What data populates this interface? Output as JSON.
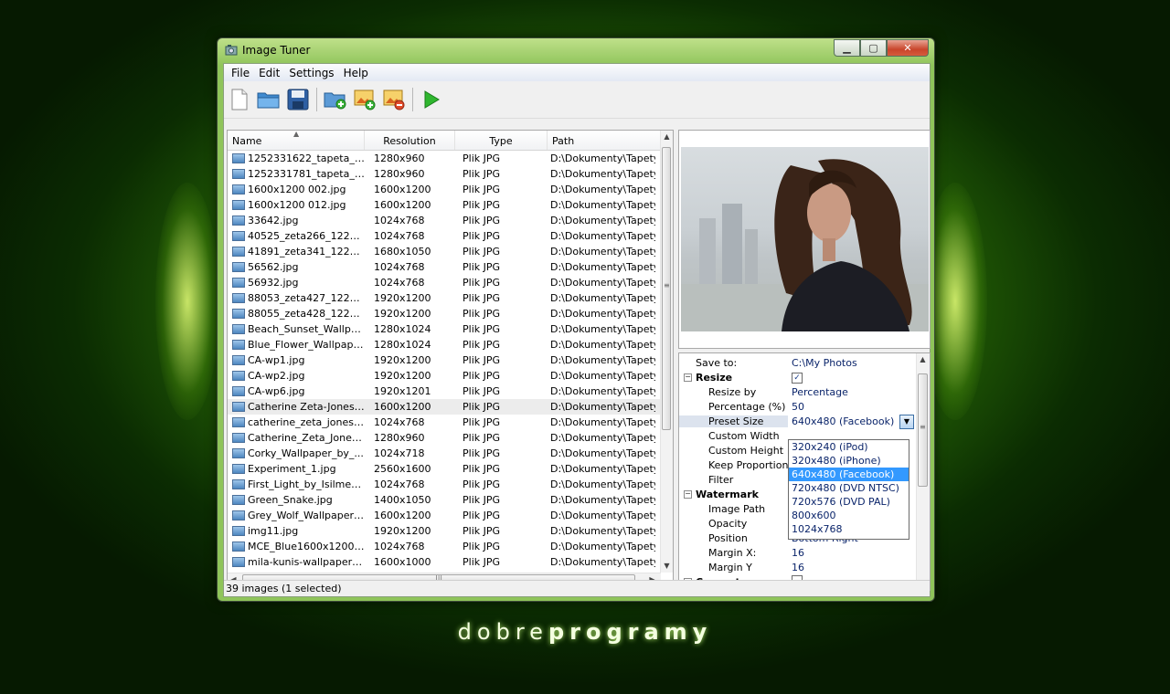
{
  "window": {
    "title": "Image Tuner"
  },
  "menu": [
    "File",
    "Edit",
    "Settings",
    "Help"
  ],
  "toolbar": [
    "new-icon",
    "open-icon",
    "save-icon",
    "add-folder-icon",
    "add-image-icon",
    "remove-image-icon",
    "run-icon"
  ],
  "filelist": {
    "columns": [
      "Name",
      "Resolution",
      "Type",
      "Path"
    ],
    "rows": [
      [
        "1252331622_tapeta_zi...",
        "1280x960",
        "Plik JPG",
        "D:\\Dokumenty\\Tapety\\"
      ],
      [
        "1252331781_tapeta_zi...",
        "1280x960",
        "Plik JPG",
        "D:\\Dokumenty\\Tapety\\"
      ],
      [
        "1600x1200 002.jpg",
        "1600x1200",
        "Plik JPG",
        "D:\\Dokumenty\\Tapety\\"
      ],
      [
        "1600x1200 012.jpg",
        "1600x1200",
        "Plik JPG",
        "D:\\Dokumenty\\Tapety\\"
      ],
      [
        "33642.jpg",
        "1024x768",
        "Plik JPG",
        "D:\\Dokumenty\\Tapety\\"
      ],
      [
        "40525_zeta266_122_4...",
        "1024x768",
        "Plik JPG",
        "D:\\Dokumenty\\Tapety\\"
      ],
      [
        "41891_zeta341_122_6...",
        "1680x1050",
        "Plik JPG",
        "D:\\Dokumenty\\Tapety\\"
      ],
      [
        "56562.jpg",
        "1024x768",
        "Plik JPG",
        "D:\\Dokumenty\\Tapety\\"
      ],
      [
        "56932.jpg",
        "1024x768",
        "Plik JPG",
        "D:\\Dokumenty\\Tapety\\"
      ],
      [
        "88053_zeta427_122_5...",
        "1920x1200",
        "Plik JPG",
        "D:\\Dokumenty\\Tapety\\"
      ],
      [
        "88055_zeta428_122_2...",
        "1920x1200",
        "Plik JPG",
        "D:\\Dokumenty\\Tapety\\"
      ],
      [
        "Beach_Sunset_Wallpap...",
        "1280x1024",
        "Plik JPG",
        "D:\\Dokumenty\\Tapety\\"
      ],
      [
        "Blue_Flower_Wallpaper...",
        "1280x1024",
        "Plik JPG",
        "D:\\Dokumenty\\Tapety\\"
      ],
      [
        "CA-wp1.jpg",
        "1920x1200",
        "Plik JPG",
        "D:\\Dokumenty\\Tapety\\"
      ],
      [
        "CA-wp2.jpg",
        "1920x1200",
        "Plik JPG",
        "D:\\Dokumenty\\Tapety\\"
      ],
      [
        "CA-wp6.jpg",
        "1920x1201",
        "Plik JPG",
        "D:\\Dokumenty\\Tapety\\"
      ],
      [
        "Catherine Zeta-Jones_...",
        "1600x1200",
        "Plik JPG",
        "D:\\Dokumenty\\Tapety\\"
      ],
      [
        "catherine_zeta_jones_...",
        "1024x768",
        "Plik JPG",
        "D:\\Dokumenty\\Tapety\\"
      ],
      [
        "Catherine_Zeta_Jones...",
        "1280x960",
        "Plik JPG",
        "D:\\Dokumenty\\Tapety\\"
      ],
      [
        "Corky_Wallpaper_by_...",
        "1024x718",
        "Plik JPG",
        "D:\\Dokumenty\\Tapety\\"
      ],
      [
        "Experiment_1.jpg",
        "2560x1600",
        "Plik JPG",
        "D:\\Dokumenty\\Tapety\\"
      ],
      [
        "First_Light_by_Isilmetri...",
        "1024x768",
        "Plik JPG",
        "D:\\Dokumenty\\Tapety\\"
      ],
      [
        "Green_Snake.jpg",
        "1400x1050",
        "Plik JPG",
        "D:\\Dokumenty\\Tapety\\"
      ],
      [
        "Grey_Wolf_Wallpaper_...",
        "1600x1200",
        "Plik JPG",
        "D:\\Dokumenty\\Tapety\\"
      ],
      [
        "img11.jpg",
        "1920x1200",
        "Plik JPG",
        "D:\\Dokumenty\\Tapety\\"
      ],
      [
        "MCE_Blue1600x1200.jpg",
        "1024x768",
        "Plik JPG",
        "D:\\Dokumenty\\Tapety\\"
      ],
      [
        "mila-kunis-wallpapers_...",
        "1600x1000",
        "Plik JPG",
        "D:\\Dokumenty\\Tapety\\"
      ]
    ],
    "selected_row": 16
  },
  "props": {
    "save_to_label": "Save to:",
    "save_to_value": "C:\\My Photos",
    "resize_label": "Resize",
    "resize_checked": "✓",
    "resize_by_label": "Resize by",
    "resize_by_value": "Percentage",
    "percentage_label": "Percentage (%)",
    "percentage_value": "50",
    "preset_label": "Preset Size",
    "preset_value": "640x480 (Facebook)",
    "custom_width_label": "Custom Width",
    "custom_height_label": "Custom Height",
    "keep_prop_label": "Keep Proportions",
    "filter_label": "Filter",
    "watermark_label": "Watermark",
    "image_path_label": "Image Path",
    "opacity_label": "Opacity",
    "position_label": "Position",
    "position_value": "Bottom Right",
    "margin_x_label": "Margin X:",
    "margin_x_value": "16",
    "margin_y_label": "Margin Y",
    "margin_y_value": "16",
    "convert_label": "Convert"
  },
  "dropdown": {
    "options": [
      "320x240 (iPod)",
      "320x480 (iPhone)",
      "640x480 (Facebook)",
      "720x480 (DVD NTSC)",
      "720x576 (DVD PAL)",
      "800x600",
      "1024x768"
    ],
    "active": 2
  },
  "status": "39 images (1 selected)",
  "brand": {
    "light": "dobre",
    "bold": "programy"
  }
}
